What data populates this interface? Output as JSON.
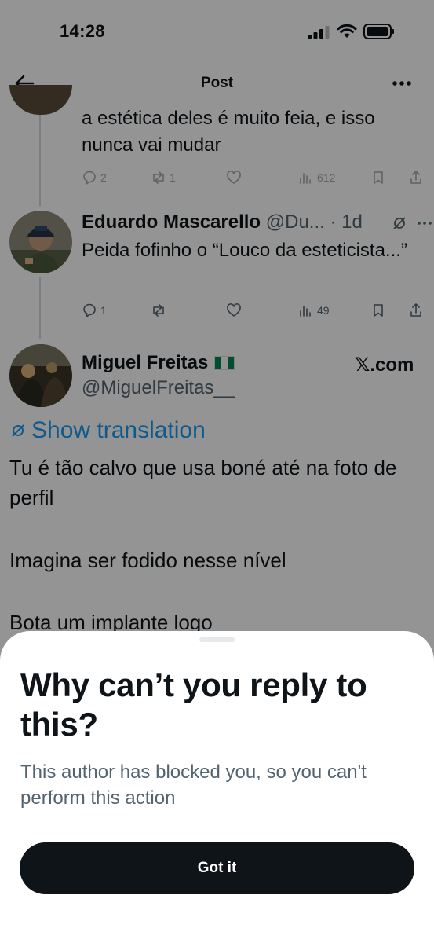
{
  "status_bar": {
    "time": "14:28"
  },
  "header": {
    "title": "Post"
  },
  "tweet1": {
    "text": "a estética deles é muito feia, e isso nunca vai mudar",
    "replies": "2",
    "reposts": "1",
    "views": "612"
  },
  "tweet2": {
    "name": "Eduardo Mascarello",
    "handle": "@Du...",
    "time": "· 1d",
    "text": "Peida fofinho o “Louco da esteticista...”",
    "replies": "1",
    "views": "49"
  },
  "tweet3": {
    "name": "Miguel Freitas",
    "handle": "@MiguelFreitas__",
    "source": "𝕏.com",
    "show_translation": "Show translation",
    "line1": "Tu é tão calvo que usa boné até na foto de perfil",
    "line2": "Imagina ser fodido nesse nível",
    "line3": "Bota um implante logo"
  },
  "sheet": {
    "title": "Why can’t you reply to this?",
    "body": "This author has blocked you, so you can't perform this action",
    "button_label": "Got it"
  },
  "colors": {
    "accent": "#1d9bf0",
    "text": "#0f1419",
    "secondary": "#536471",
    "button": "#0f1419"
  }
}
